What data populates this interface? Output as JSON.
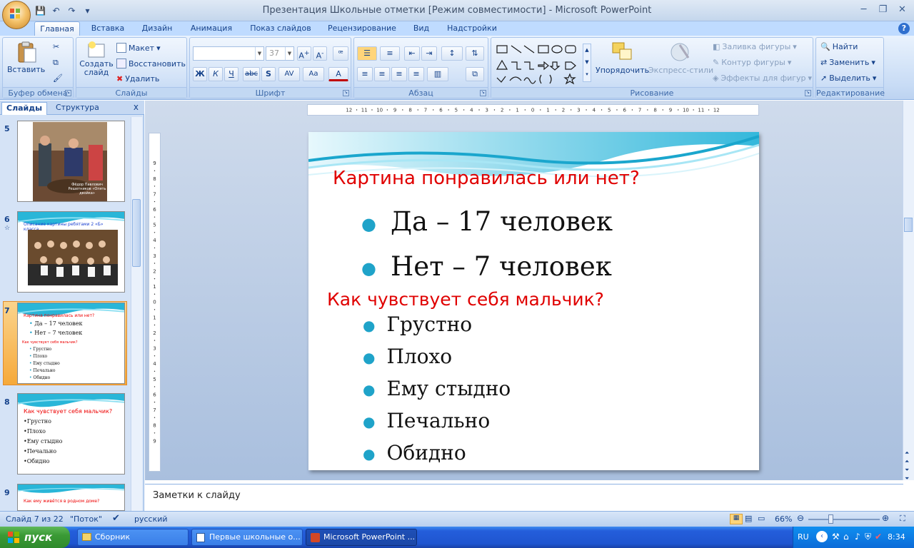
{
  "window": {
    "title": "Презентация Школьные отметки [Режим совместимости] - Microsoft PowerPoint"
  },
  "tabs": [
    {
      "label": "Главная",
      "active": true
    },
    {
      "label": "Вставка"
    },
    {
      "label": "Дизайн"
    },
    {
      "label": "Анимация"
    },
    {
      "label": "Показ слайдов"
    },
    {
      "label": "Рецензирование"
    },
    {
      "label": "Вид"
    },
    {
      "label": "Надстройки"
    }
  ],
  "ribbon": {
    "clipboard": {
      "label": "Буфер обмена",
      "paste": "Вставить"
    },
    "slides": {
      "label": "Слайды",
      "new_slide": "Создать слайд",
      "layout": "Макет",
      "reset": "Восстановить",
      "delete": "Удалить"
    },
    "font": {
      "label": "Шрифт",
      "font_name": "",
      "font_size": "37",
      "bold": "Ж",
      "italic": "К",
      "underline": "Ч",
      "strike": "abc",
      "shadow": "S",
      "spacing": "AV",
      "case": "Aa"
    },
    "paragraph": {
      "label": "Абзац"
    },
    "drawing": {
      "label": "Рисование",
      "arrange": "Упорядочить",
      "quick_styles": "Экспресс-стили",
      "shape_fill": "Заливка фигуры",
      "shape_outline": "Контур фигуры",
      "shape_effects": "Эффекты для фигур"
    },
    "editing": {
      "label": "Редактирование",
      "find": "Найти",
      "replace": "Заменить",
      "select": "Выделить"
    }
  },
  "left_pane": {
    "tab_slides": "Слайды",
    "tab_outline": "Структура",
    "close": "x",
    "thumbs": [
      {
        "num": "5",
        "caption": "Фёдор Павлович Решетников «Опять двойка»"
      },
      {
        "num": "6",
        "title": "Описание картины  ребятами 2 «Б» класса"
      },
      {
        "num": "7",
        "title": "Картина понравилась или нет?",
        "b1": "Да – 17 человек",
        "b2": "Нет – 7 человек",
        "sub": "Как чувствует себя мальчик?",
        "items": [
          "Грустно",
          "Плохо",
          "Ему стыдно",
          "Печально",
          "Обидно"
        ]
      },
      {
        "num": "8",
        "title": "Как чувствует себя мальчик?",
        "items": [
          "•Грустно",
          "•Плохо",
          "•Ему стыдно",
          "•Печально",
          "•Обидно"
        ]
      },
      {
        "num": "9",
        "title": "Как ему живётся в родном доме?"
      }
    ]
  },
  "slide": {
    "title": "Картина понравилась или нет?",
    "bullets": [
      "Да – 17 человек",
      "Нет – 7 человек"
    ],
    "subtitle": "Как чувствует себя мальчик?",
    "items": [
      "Грустно",
      "Плохо",
      "Ему стыдно",
      "Печально",
      "Обидно"
    ]
  },
  "notes": {
    "placeholder": "Заметки к слайду"
  },
  "status": {
    "slide_info": "Слайд 7 из 22",
    "theme": "\"Поток\"",
    "language": "русский",
    "zoom": "66%"
  },
  "taskbar": {
    "start": "пуск",
    "tasks": [
      "Сборник",
      "Первые школьные о...",
      "Microsoft PowerPoint ..."
    ],
    "lang": "RU",
    "time": "8:34"
  },
  "colors": {
    "accent": "#15428b",
    "slide_title": "#e00000",
    "bullet": "#1fa3c9"
  }
}
